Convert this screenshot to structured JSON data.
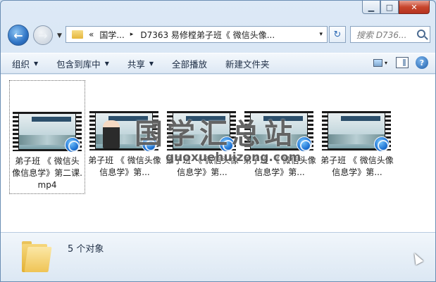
{
  "window": {
    "minimize_glyph": "▁",
    "maximize_glyph": "□",
    "close_glyph": "✕"
  },
  "nav": {
    "address_parts": [
      "«",
      "国学...",
      "▸",
      "D7363 易修樘弟子班《 微信头像..."
    ],
    "address_dropdown_glyph": "▾",
    "refresh_glyph": "↻",
    "search_placeholder": "搜索 D736..."
  },
  "toolbar": {
    "items": [
      "组织",
      "包含到库中",
      "共享",
      "全部播放",
      "新建文件夹"
    ],
    "has_arrow": [
      true,
      true,
      true,
      false,
      false
    ],
    "view_arrow": "▾",
    "help_glyph": "?"
  },
  "files": [
    {
      "name": "弟子班 《 微信头像信息学》第二课.mp4",
      "selected": true,
      "person": false
    },
    {
      "name": "弟子班 《 微信头像信息学》第...",
      "selected": false,
      "person": true
    },
    {
      "name": "弟子班 《 微信头像信息学》第...",
      "selected": false,
      "person": false
    },
    {
      "name": "弟子班 《 微信头像信息学》第...",
      "selected": false,
      "person": false
    },
    {
      "name": "弟子班 《 微信头像信息学》第...",
      "selected": false,
      "person": false
    }
  ],
  "watermark": {
    "title": "国学汇总站",
    "url": "guoxuehuizong.com"
  },
  "details": {
    "count": "5 个对象"
  },
  "colors": {
    "accent": "#2f74c5",
    "window_bg": "#cfe0f1"
  }
}
